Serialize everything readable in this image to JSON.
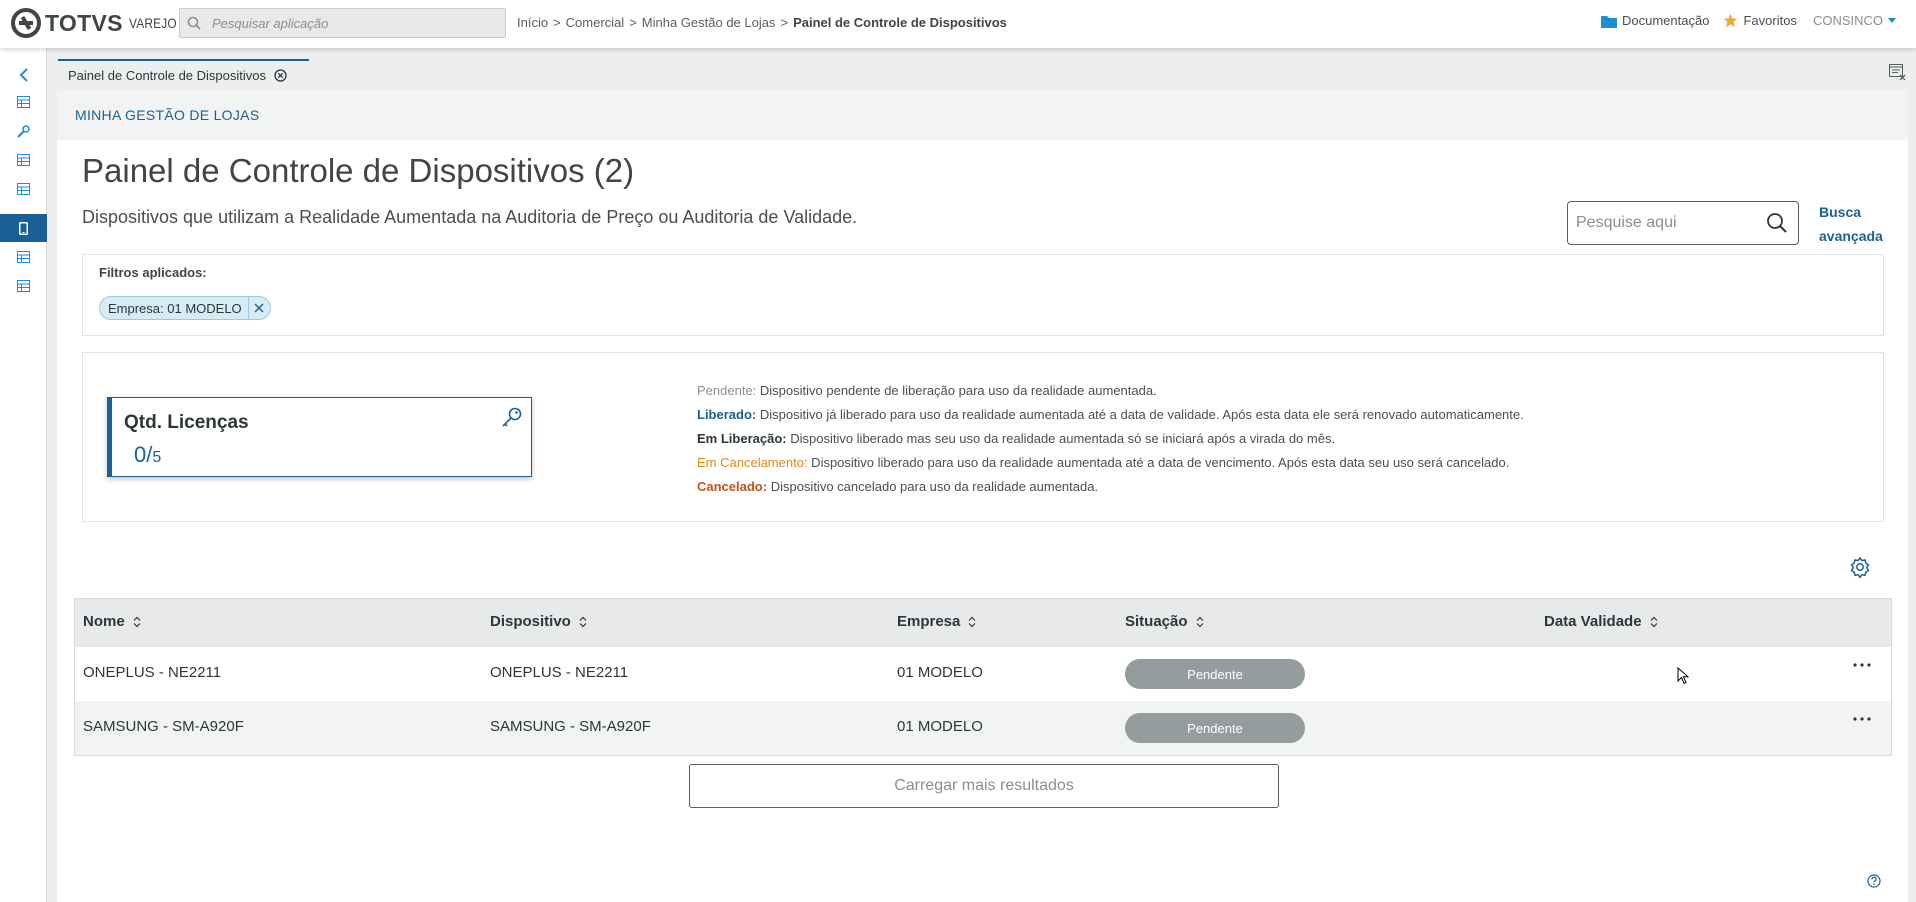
{
  "header": {
    "brand": "TOTVS",
    "brand_sub": "VAREJO",
    "search_placeholder": "Pesquisar aplicação",
    "breadcrumb": [
      "Início",
      "Comercial",
      "Minha Gestão de Lojas",
      "Painel de Controle de Dispositivos"
    ],
    "breadcrumb_sep": ">",
    "documentation": "Documentação",
    "favorites": "Favoritos",
    "user": "CONSINCO"
  },
  "tab": {
    "label": "Painel de Controle de Dispositivos"
  },
  "section": {
    "title": "MINHA GESTÃO DE LOJAS"
  },
  "page": {
    "title": "Painel de Controle de Dispositivos (2)",
    "subtitle": "Dispositivos que utilizam a Realidade Aumentada na Auditoria de Preço ou Auditoria de Validade.",
    "search_placeholder": "Pesquise aqui",
    "advanced_line1": "Busca",
    "advanced_line2": "avançada"
  },
  "filters": {
    "label": "Filtros aplicados:",
    "chips": [
      {
        "label": "Empresa: 01 MODELO"
      }
    ]
  },
  "widget": {
    "title": "Qtd. Licenças",
    "value": "0/",
    "total": "5"
  },
  "legend": [
    {
      "term": "Pendente:",
      "text": " Dispositivo pendente de liberação para uso da realidade aumentada.",
      "color": "#8a9092",
      "bold": false
    },
    {
      "term": "Liberado:",
      "text": " Dispositivo já liberado para uso da realidade aumentada até a data de validade. Após esta data ele será renovado automaticamente.",
      "color": "#1a5f96",
      "bold": true
    },
    {
      "term": "Em Liberação:",
      "text": " Dispositivo liberado mas seu uso da realidade aumentada só se iniciará após a virada do mês.",
      "color": "#2c3739",
      "bold": true
    },
    {
      "term": "Em Cancelamento:",
      "text": " Dispositivo liberado para uso da realidade aumentada até a data de vencimento. Após esta data seu uso será cancelado.",
      "color": "#e5861c",
      "bold": false
    },
    {
      "term": "Cancelado:",
      "text": " Dispositivo cancelado para uso da realidade aumentada.",
      "color": "#c4521b",
      "bold": true
    }
  ],
  "table": {
    "columns": [
      "Nome",
      "Dispositivo",
      "Empresa",
      "Situação",
      "Data Validade"
    ],
    "rows": [
      {
        "nome": "ONEPLUS - NE2211",
        "dispositivo": "ONEPLUS - NE2211",
        "empresa": "01 MODELO",
        "situacao": "Pendente",
        "data_validade": ""
      },
      {
        "nome": "SAMSUNG - SM-A920F",
        "dispositivo": "SAMSUNG - SM-A920F",
        "empresa": "01 MODELO",
        "situacao": "Pendente",
        "data_validade": ""
      }
    ]
  },
  "load_more": "Carregar mais resultados",
  "colors": {
    "primary": "#1a5f96",
    "status_pending": "#959c9e",
    "favorites_star": "#f0a830"
  },
  "icons": {
    "sidebar": [
      "chevron-left-icon",
      "table-icon",
      "wrench-icon",
      "table-icon",
      "table-icon",
      "mobile-icon",
      "table-icon",
      "table-icon"
    ]
  }
}
